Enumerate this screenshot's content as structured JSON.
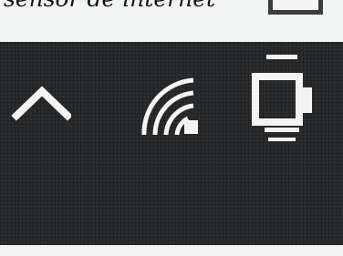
{
  "caption": {
    "text": "sensor de internet"
  },
  "tray": {
    "icons": [
      {
        "name": "chevron-up-icon",
        "meaning": "show hidden icons"
      },
      {
        "name": "wifi-icon",
        "meaning": "network status"
      },
      {
        "name": "battery-icon",
        "meaning": "battery status"
      }
    ]
  },
  "colors": {
    "taskbar": "#2b2c2e",
    "icon": "#f4f4f4",
    "top_strip": "#f2f3f3"
  }
}
